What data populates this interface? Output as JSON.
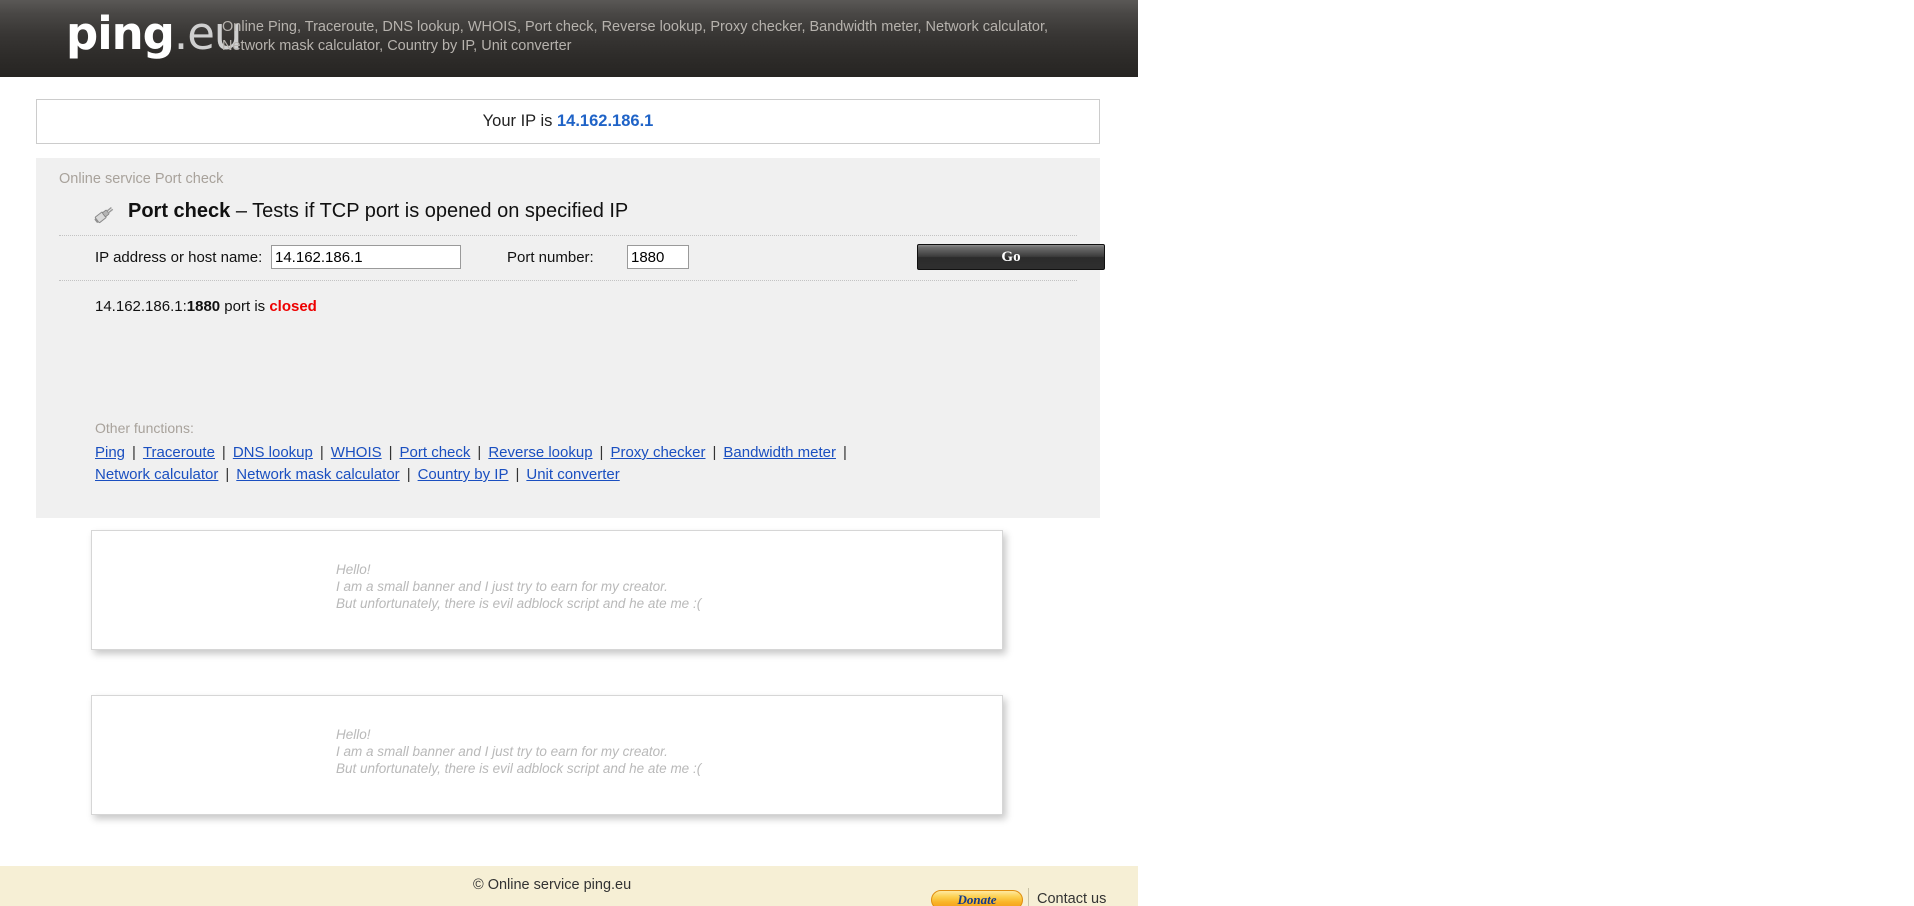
{
  "header": {
    "logo_main": "ping",
    "logo_dot": ".",
    "logo_tld": "eu",
    "tagline": "Online Ping, Traceroute, DNS lookup, WHOIS, Port check, Reverse lookup, Proxy checker, Bandwidth meter, Network calculator,\nNetwork mask calculator, Country by IP, Unit converter"
  },
  "ip_bar": {
    "prefix": "Your IP is ",
    "ip": "14.162.186.1"
  },
  "panel": {
    "kicker": "Online service Port check",
    "title_name": "Port check",
    "title_desc": " – Tests if TCP port is opened on specified IP",
    "icon": "plug-icon",
    "form": {
      "host_label": "IP address or host name:",
      "host_value": "14.162.186.1",
      "host_placeholder": "",
      "port_label": "Port number:",
      "port_value": "1880",
      "port_placeholder": "",
      "submit_label": "Go"
    },
    "result": {
      "host": "14.162.186.1:",
      "port": "1880",
      "middle": " port is ",
      "state": "closed",
      "state_color": "#ee0000"
    },
    "other_functions_label": "Other functions:",
    "links": [
      "Ping",
      "Traceroute",
      "DNS lookup",
      "WHOIS",
      "Port check",
      "Reverse lookup",
      "Proxy checker",
      "Bandwidth meter",
      "Network calculator",
      "Network mask calculator",
      "Country by IP",
      "Unit converter"
    ],
    "link_separator": "|"
  },
  "banners": [
    {
      "text": "Hello!\nI am a small banner and I just try to earn for my creator.\nBut unfortunately, there is evil adblock script and he ate me :("
    },
    {
      "text": "Hello!\nI am a small banner and I just try to earn for my creator.\nBut unfortunately, there is evil adblock script and he ate me :("
    }
  ],
  "footer": {
    "copyright": "© Online service ping.eu",
    "donate_label": "Donate",
    "contact_label": "Contact us"
  },
  "colors": {
    "accent_blue": "#1f63c7",
    "link_blue": "#1a4fc0",
    "error_red": "#ee0000",
    "page_cream": "#f6efd5",
    "panel_gray": "#f0f0f0"
  }
}
